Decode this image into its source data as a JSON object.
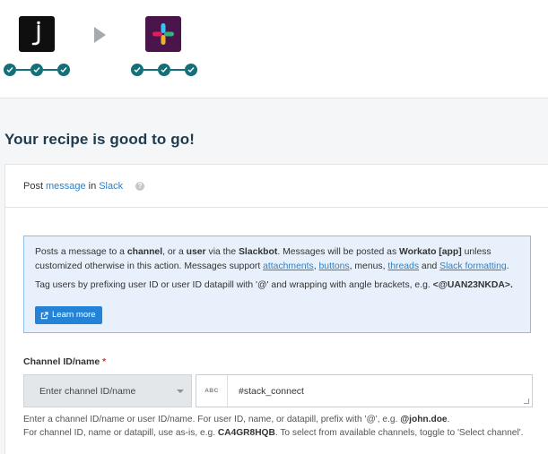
{
  "flow": {
    "source_app_icon": "workato-j-icon",
    "target_app_icon": "slack-icon",
    "arrow_icon": "play-arrow-icon",
    "step_icon": "check-icon"
  },
  "page_title": "Your recipe is good to go!",
  "action": {
    "prefix": "Post",
    "object": "message",
    "conj": "in",
    "app": "Slack",
    "help_glyph": "?"
  },
  "info": {
    "p1": [
      {
        "t": "Posts a message to a ",
        "s": "n"
      },
      {
        "t": "channel",
        "s": "b"
      },
      {
        "t": ", or a ",
        "s": "n"
      },
      {
        "t": "user",
        "s": "b"
      },
      {
        "t": " via the ",
        "s": "n"
      },
      {
        "t": "Slackbot",
        "s": "b"
      },
      {
        "t": ". Messages will be posted as ",
        "s": "n"
      },
      {
        "t": "Workato [app]",
        "s": "b"
      },
      {
        "t": " unless customized otherwise in this action. Messages support ",
        "s": "n"
      },
      {
        "t": "attachments",
        "s": "a"
      },
      {
        "t": ", ",
        "s": "n"
      },
      {
        "t": "buttons",
        "s": "a"
      },
      {
        "t": ", menus, ",
        "s": "n"
      },
      {
        "t": "threads",
        "s": "a"
      },
      {
        "t": " and ",
        "s": "n"
      },
      {
        "t": "Slack formatting",
        "s": "a"
      },
      {
        "t": ".",
        "s": "n"
      }
    ],
    "p2": [
      {
        "t": "Tag users by prefixing user ID or user ID datapill with '@' and wrapping with angle brackets, e.g. ",
        "s": "n"
      },
      {
        "t": "<@UAN23NKDA>.",
        "s": "b"
      }
    ],
    "learn_more": "Learn more"
  },
  "field": {
    "label": "Channel ID/name",
    "required_mark": "*",
    "mode_label": "Enter channel ID/name",
    "type_badge": "ABC",
    "value": "#stack_connect",
    "hint1": [
      {
        "t": "Enter a channel ID/name or user ID/name. For user ID, name, or datapill, prefix with '@', e.g. ",
        "s": "n"
      },
      {
        "t": "@john.doe",
        "s": "b"
      },
      {
        "t": ".",
        "s": "n"
      }
    ],
    "hint2": [
      {
        "t": "For channel ID, name or datapill, use as-is, e.g. ",
        "s": "n"
      },
      {
        "t": "CA4GR8HQB",
        "s": "b"
      },
      {
        "t": ". To select from available channels, toggle to 'Select channel'.",
        "s": "n"
      }
    ]
  }
}
